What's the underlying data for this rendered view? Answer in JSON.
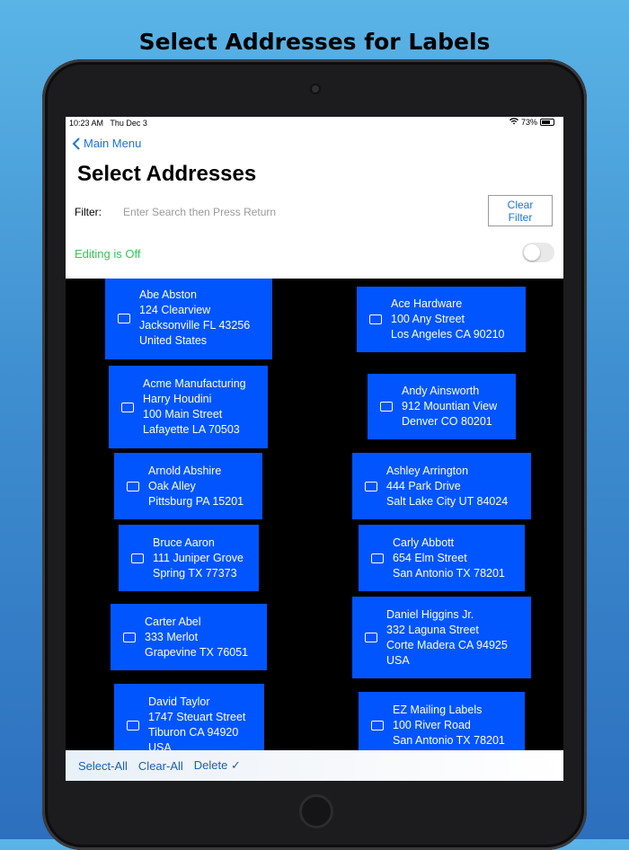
{
  "headline": "Select Addresses for Labels",
  "status": {
    "time": "10:23 AM",
    "date": "Thu Dec 3",
    "battery": "73%"
  },
  "nav": {
    "back_label": "Main Menu"
  },
  "page_title": "Select Addresses",
  "filter": {
    "label": "Filter:",
    "placeholder": "Enter Search then Press Return",
    "clear_label": "Clear Filter"
  },
  "editing": {
    "label": "Editing is Off",
    "on": false
  },
  "addresses": [
    {
      "lines": [
        "Abe Abston",
        "124 Clearview",
        "Jacksonville FL 43256",
        "United States"
      ]
    },
    {
      "lines": [
        "Ace Hardware",
        "100 Any Street",
        "Los Angeles CA 90210"
      ]
    },
    {
      "lines": [
        "Acme Manufacturing",
        "Harry Houdini",
        "100 Main Street",
        "Lafayette LA 70503"
      ]
    },
    {
      "lines": [
        "Andy Ainsworth",
        "912 Mountian View",
        "Denver CO 80201"
      ]
    },
    {
      "lines": [
        "Arnold Abshire",
        "Oak Alley",
        "Pittsburg PA 15201"
      ]
    },
    {
      "lines": [
        "Ashley Arrington",
        "444 Park Drive",
        "Salt Lake City UT 84024"
      ]
    },
    {
      "lines": [
        "Bruce Aaron",
        "111 Juniper Grove",
        "Spring TX 77373"
      ]
    },
    {
      "lines": [
        "Carly Abbott",
        "654 Elm Street",
        "San Antonio TX 78201"
      ]
    },
    {
      "lines": [
        "Carter Abel",
        "333 Merlot",
        "Grapevine TX 76051"
      ]
    },
    {
      "lines": [
        "Daniel Higgins Jr.",
        "332 Laguna Street",
        "Corte Madera CA 94925",
        "USA"
      ]
    },
    {
      "lines": [
        "David Taylor",
        "1747 Steuart Street",
        "Tiburon CA 94920",
        "USA"
      ]
    },
    {
      "lines": [
        "EZ Mailing Labels",
        "100 River Road",
        "San Antonio TX 78201"
      ]
    }
  ],
  "toolbar": {
    "select_all": "Select-All",
    "clear_all": "Clear-All",
    "delete": "Delete ✓"
  },
  "colors": {
    "card": "#0055ff",
    "link": "#1a73e8",
    "editing_text": "#34c759"
  }
}
